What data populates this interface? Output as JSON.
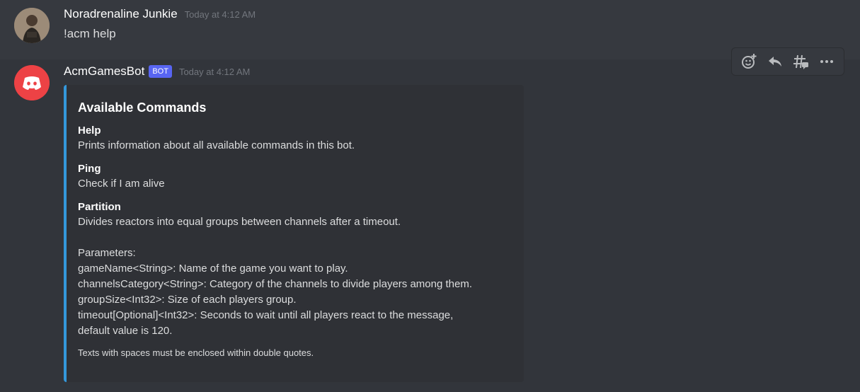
{
  "user_message": {
    "username": "Noradrenaline Junkie",
    "timestamp": "Today at 4:12 AM",
    "text": "!acm help"
  },
  "bot_message": {
    "username": "AcmGamesBot",
    "badge": "BOT",
    "timestamp": "Today at 4:12 AM",
    "embed": {
      "accent_color": "#3498db",
      "title": "Available Commands",
      "fields": [
        {
          "name": "Help",
          "value": "Prints information about all available commands in this bot."
        },
        {
          "name": "Ping",
          "value": "Check if I am alive"
        },
        {
          "name": "Partition",
          "value": "Divides reactors into equal groups between channels after a timeout.\n\nParameters:\ngameName<String>: Name of the game you want to play.\nchannelsCategory<String>: Category of the channels to divide players among them.\ngroupSize<Int32>: Size of each players group.\ntimeout[Optional]<Int32>: Seconds to wait until all players react to the message,\ndefault value is 120."
        }
      ],
      "footer": "Texts with spaces must be enclosed within double quotes."
    }
  },
  "toolbar": {
    "icons": [
      "add-reaction-icon",
      "reply-icon",
      "create-thread-icon",
      "more-icon"
    ]
  },
  "colors": {
    "background": "#36393f",
    "bot_badge": "#5865f2",
    "bot_avatar": "#ed4245"
  }
}
